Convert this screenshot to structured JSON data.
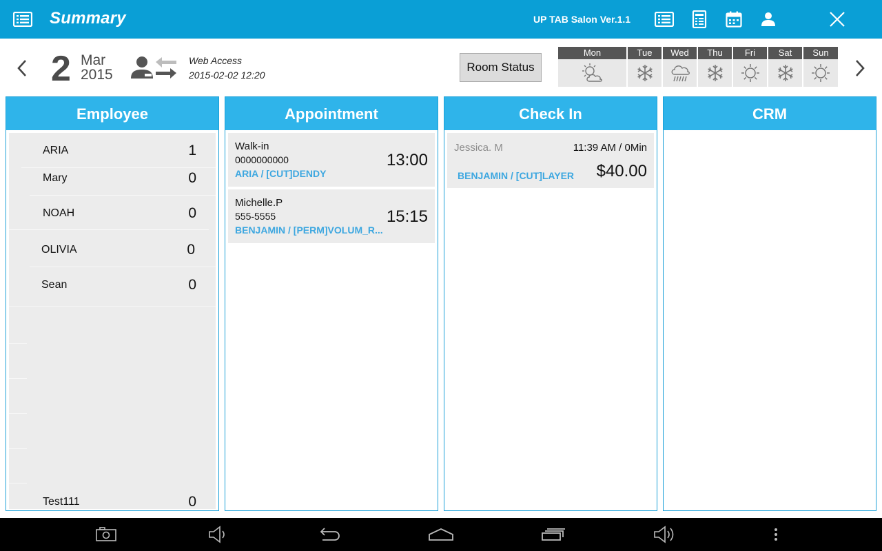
{
  "app": {
    "title": "Summary",
    "version": "UP TAB Salon Ver.1.1",
    "topbar_icons": [
      "list-icon",
      "receipt-icon",
      "calendar-icon",
      "person-icon"
    ],
    "close_icon": "close-icon",
    "accent_color": "#0a9fd6"
  },
  "date": {
    "day": "2",
    "month": "Mar",
    "year": "2015"
  },
  "web_access": {
    "label": "Web Access",
    "timestamp": "2015-02-02 12:20"
  },
  "room_status_label": "Room Status",
  "weather": [
    {
      "day": "Mon",
      "icon": "partly-cloudy-icon"
    },
    {
      "day": "Tue",
      "icon": "snow-icon"
    },
    {
      "day": "Wed",
      "icon": "rain-icon"
    },
    {
      "day": "Thu",
      "icon": "snow-icon"
    },
    {
      "day": "Fri",
      "icon": "sun-icon"
    },
    {
      "day": "Sat",
      "icon": "snow-icon"
    },
    {
      "day": "Sun",
      "icon": "sun-icon"
    }
  ],
  "panels": {
    "employee": {
      "title": "Employee",
      "rows": [
        {
          "name": "ARIA",
          "count": "1"
        },
        {
          "name": "Mary",
          "count": "0"
        },
        {
          "name": "NOAH",
          "count": "0"
        },
        {
          "name": "OLIVIA",
          "count": "0"
        },
        {
          "name": "Sean",
          "count": "0"
        },
        {
          "name": "Test111",
          "count": "0"
        }
      ]
    },
    "appointment": {
      "title": "Appointment",
      "items": [
        {
          "name": "Walk-in",
          "phone": "0000000000",
          "service": "ARIA / [CUT]DENDY",
          "time": "13:00"
        },
        {
          "name": "Michelle.P",
          "phone": "555-5555",
          "service": "BENJAMIN / [PERM]VOLUM_R...",
          "time": "15:15"
        }
      ]
    },
    "checkin": {
      "title": "Check In",
      "items": [
        {
          "name": "Jessica. M",
          "time": "11:39 AM / 0Min",
          "service": "BENJAMIN / [CUT]LAYER",
          "amount": "$40.00"
        }
      ]
    },
    "crm": {
      "title": "CRM"
    }
  },
  "navbar_icons": [
    "screenshot-icon",
    "volume-down-icon",
    "back-icon",
    "home-icon",
    "recent-apps-icon",
    "volume-up-icon",
    "more-icon"
  ]
}
